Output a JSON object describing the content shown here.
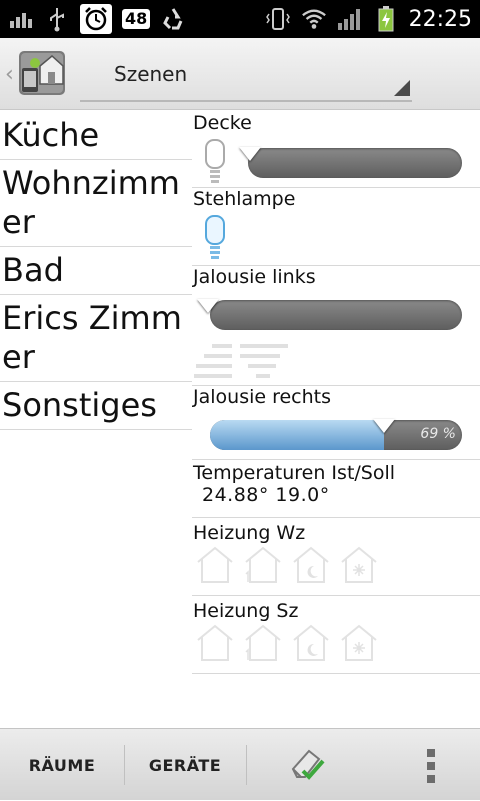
{
  "statusbar": {
    "icons": [
      "signal-bars-icon",
      "usb-icon",
      "alarm-clock-icon",
      "notification-count-badge",
      "recycle-icon",
      "vibrate-icon",
      "wifi-icon",
      "cell-signal-icon",
      "battery-charging-icon"
    ],
    "badge_count": "48",
    "time": "22:25"
  },
  "actionbar": {
    "title": "Szenen",
    "logo_icon": "home-app-icon"
  },
  "rooms": [
    {
      "label": "Küche"
    },
    {
      "label": "Wohnzimmer"
    },
    {
      "label": "Bad"
    },
    {
      "label": "Erics Zimmer"
    },
    {
      "label": "Sonstiges"
    }
  ],
  "devices": {
    "decke": {
      "label": "Decke",
      "type": "dimmer",
      "level": 0,
      "icon": "lightbulb-off-icon"
    },
    "stehlampe": {
      "label": "Stehlampe",
      "type": "switch",
      "state": "on",
      "icon": "lightbulb-icon"
    },
    "jalousie_links": {
      "label": "Jalousie links",
      "type": "shutter",
      "level": 0,
      "icon": "shutter-icon"
    },
    "jalousie_rechts": {
      "label": "Jalousie rechts",
      "type": "shutter",
      "level": 69,
      "level_text": "69 %"
    },
    "temperaturen": {
      "label": "Temperaturen Ist/Soll",
      "values": "24.88°  19.0°"
    },
    "heizung_wz": {
      "label": "Heizung Wz",
      "modes": [
        "house-mode-icon",
        "house-1-mode-icon",
        "house-moon-mode-icon",
        "house-snowflake-mode-icon"
      ]
    },
    "heizung_sz": {
      "label": "Heizung Sz",
      "modes": [
        "house-mode-icon",
        "house-1-mode-icon",
        "house-moon-mode-icon",
        "house-snowflake-mode-icon"
      ]
    }
  },
  "bottombar": {
    "raeume_label": "RÄUME",
    "geraete_label": "GERÄTE",
    "scene_icon": "eraser-check-icon",
    "menu_icon": "overflow-menu-icon"
  },
  "colors": {
    "statusbar_bg": "#000000",
    "slider_fill": "#5b97cc",
    "slider_track": "#6e6e6e"
  }
}
